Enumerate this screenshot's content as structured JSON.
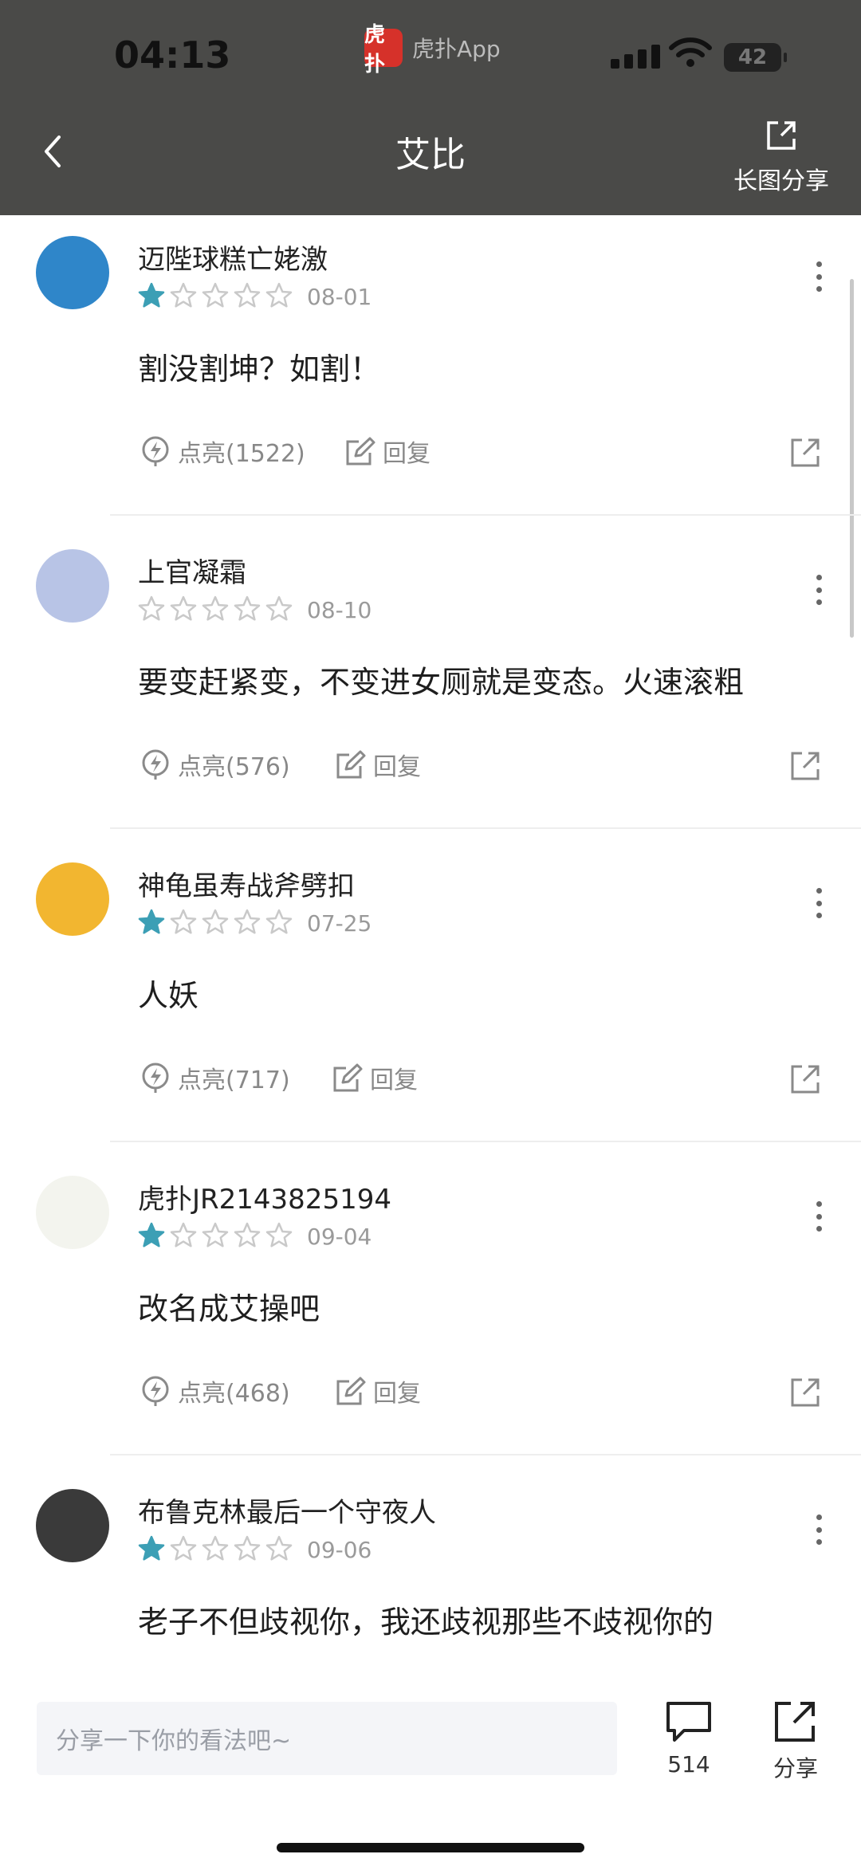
{
  "status_bar": {
    "time": "04:13",
    "app_badge_label": "虎扑App",
    "app_logo_text": "虎扑",
    "battery": "42"
  },
  "header": {
    "title": "艾比",
    "share_long_label": "长图分享"
  },
  "comments": [
    {
      "username": "迈陛球糕亡姥激",
      "rating": 1,
      "date": "08-01",
      "text": "割没割坤？如割！",
      "light_label": "点亮(1522)",
      "reply_label": "回复",
      "avatar_color": "#2f86c9"
    },
    {
      "username": "上官凝霜",
      "rating": 0,
      "date": "08-10",
      "text": "要变赶紧变，不变进女厕就是变态。火速滚粗",
      "light_label": "点亮(576)",
      "reply_label": "回复",
      "avatar_color": "#b8c4e6"
    },
    {
      "username": "神龟虽寿战斧劈扣",
      "rating": 1,
      "date": "07-25",
      "text": "人妖",
      "light_label": "点亮(717)",
      "reply_label": "回复",
      "avatar_color": "#f2b630"
    },
    {
      "username": "虎扑JR2143825194",
      "rating": 1,
      "date": "09-04",
      "text": "改名成艾操吧",
      "light_label": "点亮(468)",
      "reply_label": "回复",
      "avatar_color": "#f3f4ee"
    },
    {
      "username": "布鲁克林最后一个守夜人",
      "rating": 1,
      "date": "09-06",
      "text": "老子不但歧视你，我还歧视那些不歧视你的",
      "avatar_color": "#3a3a3a"
    }
  ],
  "bottom_bar": {
    "input_placeholder": "分享一下你的看法吧~",
    "comment_count": "514",
    "share_label": "分享"
  },
  "colors": {
    "header_bg": "#4a4a48",
    "star_filled": "#3c9fb5",
    "star_empty": "#c9c9c9",
    "action_gray": "#888888"
  }
}
